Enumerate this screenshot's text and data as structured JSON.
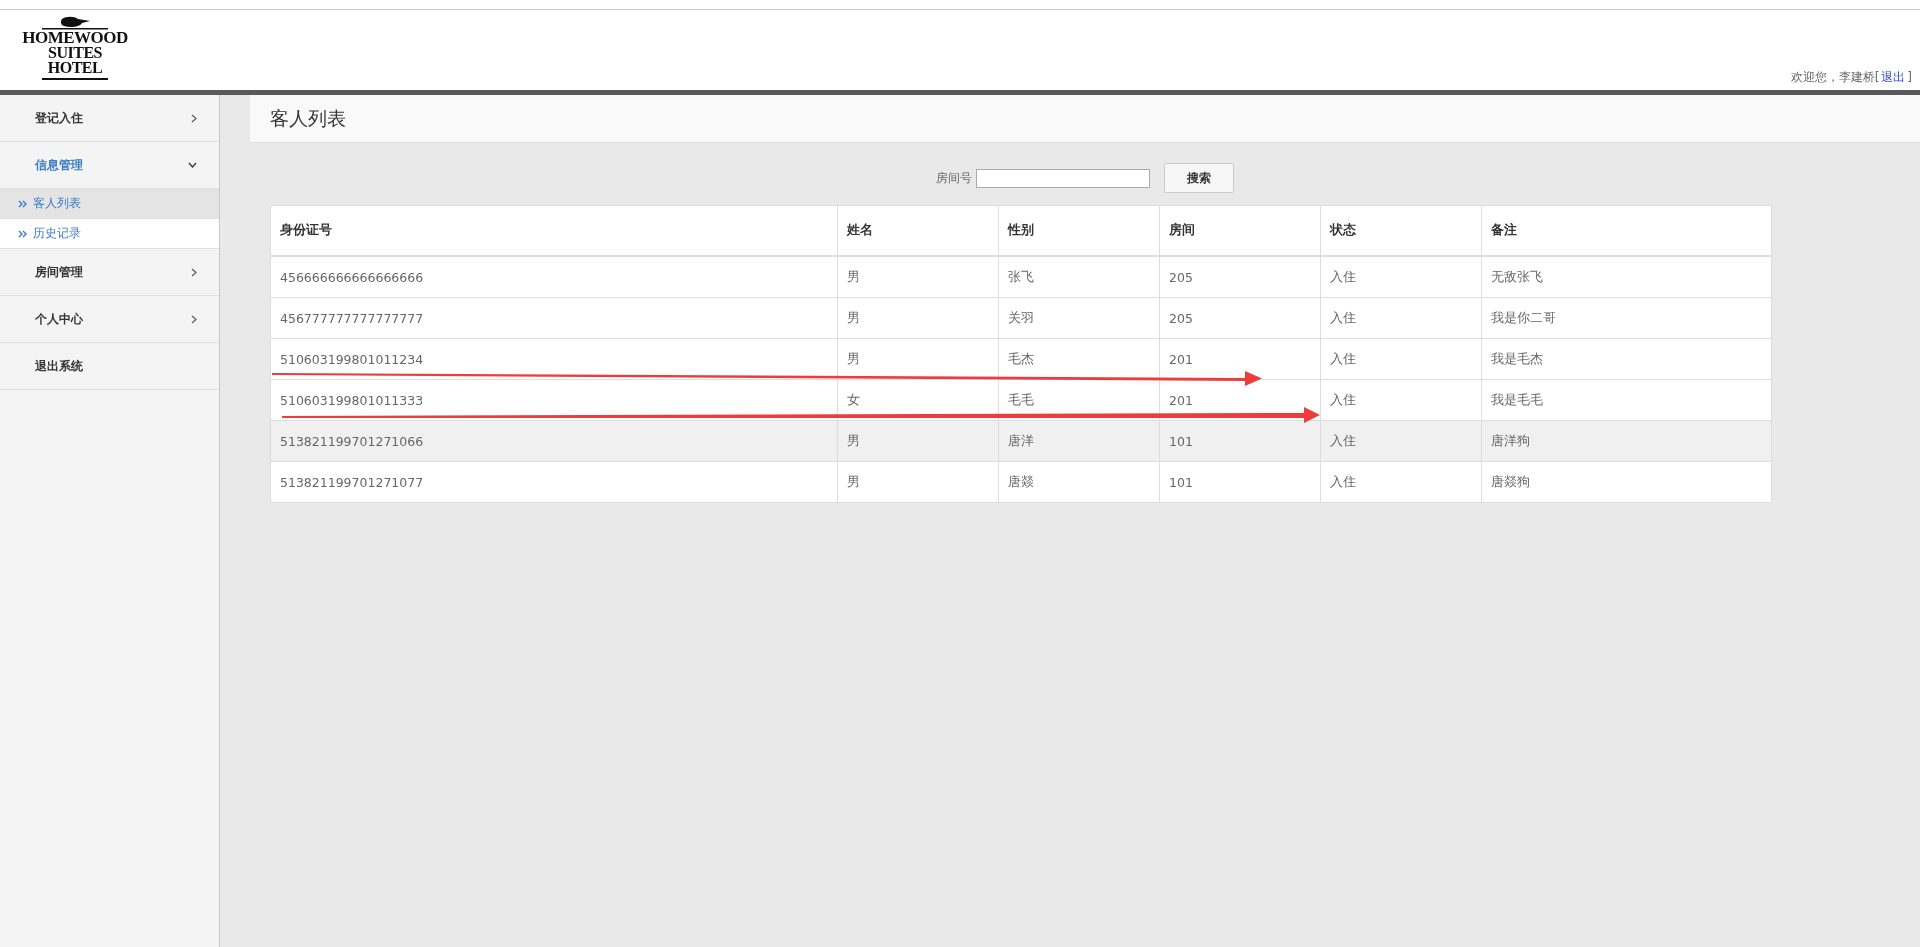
{
  "header": {
    "logo": {
      "lines": [
        "HOMEWOOD",
        "SUITES",
        "HOTEL"
      ]
    },
    "welcome": "欢迎您，李建桥[",
    "logout": "退出",
    "welcome_end": "]"
  },
  "sidebar": {
    "items": [
      {
        "label": "登记入住",
        "kind": "menu",
        "expanded": false
      },
      {
        "label": "信息管理",
        "kind": "menu",
        "expanded": true,
        "children": [
          {
            "label": "客人列表",
            "selected": true
          },
          {
            "label": "历史记录",
            "selected": false
          }
        ]
      },
      {
        "label": "房间管理",
        "kind": "menu",
        "expanded": false
      },
      {
        "label": "个人中心",
        "kind": "menu",
        "expanded": false
      },
      {
        "label": "退出系统",
        "kind": "action",
        "expanded": false
      }
    ]
  },
  "page_title": "客人列表",
  "search": {
    "label": "房间号",
    "button": "搜索"
  },
  "table": {
    "columns": [
      "身份证号",
      "姓名",
      "性别",
      "房间",
      "状态",
      "备注"
    ],
    "rows": [
      {
        "cells": [
          "456666666666666666",
          "男",
          "张飞",
          "205",
          "入住",
          "无敌张飞"
        ],
        "highlighted": false
      },
      {
        "cells": [
          "456777777777777777",
          "男",
          "关羽",
          "205",
          "入住",
          "我是你二哥"
        ],
        "highlighted": false
      },
      {
        "cells": [
          "510603199801011234",
          "男",
          "毛杰",
          "201",
          "入住",
          "我是毛杰"
        ],
        "highlighted": false
      },
      {
        "cells": [
          "510603199801011333",
          "女",
          "毛毛",
          "201",
          "入住",
          "我是毛毛"
        ],
        "highlighted": false
      },
      {
        "cells": [
          "513821199701271066",
          "男",
          "唐洋",
          "101",
          "入住",
          "唐洋狗"
        ],
        "highlighted": true
      },
      {
        "cells": [
          "513821199701271077",
          "男",
          "唐燚",
          "101",
          "入住",
          "唐燚狗"
        ],
        "highlighted": false
      }
    ]
  }
}
